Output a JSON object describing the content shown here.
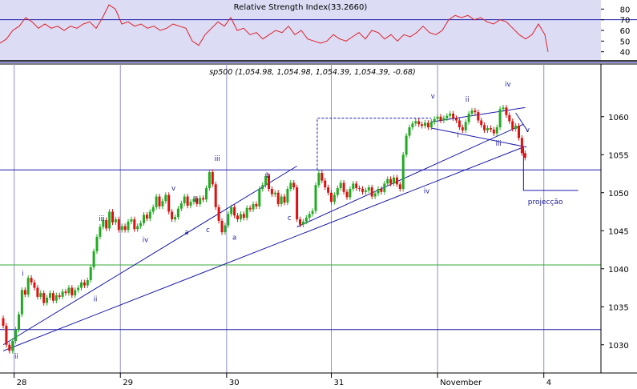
{
  "colors": {
    "background": "#ffffff",
    "rsi_background": "#dcdcf4",
    "rsi_line": "#e0202a",
    "frame": "#000000",
    "vgrid": "#9090c8",
    "blue_line": "#1a1aa8",
    "green_line": "#3aa83a",
    "bull": "#22aa22",
    "bear": "#e01010",
    "wave_label": "#1a1a9a",
    "orange_dash": "#cc3300"
  },
  "chart_data": [
    {
      "type": "line",
      "title": "Relative Strength Index(33.2660)",
      "ylim": [
        33,
        87
      ],
      "y_ticks": [
        40,
        50,
        60,
        70,
        80
      ],
      "reference_levels": [
        70,
        30
      ],
      "grid": false,
      "series": [
        {
          "x": [
            0,
            8,
            16,
            24,
            32,
            40,
            48,
            56,
            64,
            72,
            80,
            88,
            96,
            104,
            112,
            120,
            128,
            136,
            144,
            152,
            160,
            168,
            176,
            184,
            192,
            200,
            208,
            216,
            224,
            232,
            240,
            248,
            256,
            264,
            272,
            280,
            288,
            296,
            304,
            312,
            320,
            328,
            336,
            344,
            352,
            360,
            368,
            376,
            384,
            392,
            400,
            408,
            416,
            424,
            432,
            440,
            448,
            456,
            464,
            472,
            480,
            488,
            496,
            504,
            512,
            520,
            528,
            536,
            544,
            552,
            560,
            568,
            576,
            584,
            592,
            600,
            608,
            616,
            624,
            632,
            640,
            648,
            656,
            664,
            672,
            680,
            684
          ],
          "values": [
            48,
            52,
            60,
            64,
            72,
            68,
            62,
            66,
            62,
            64,
            60,
            64,
            62,
            66,
            68,
            62,
            72,
            84,
            80,
            66,
            68,
            64,
            66,
            62,
            64,
            60,
            62,
            66,
            64,
            62,
            50,
            46,
            56,
            62,
            68,
            64,
            72,
            60,
            62,
            56,
            58,
            52,
            56,
            60,
            58,
            64,
            56,
            60,
            52,
            50,
            48,
            50,
            56,
            52,
            50,
            54,
            58,
            52,
            60,
            58,
            52,
            56,
            50,
            56,
            54,
            58,
            64,
            58,
            56,
            60,
            70,
            74,
            72,
            74,
            70,
            72,
            68,
            66,
            70,
            68,
            62,
            56,
            52,
            56,
            66,
            56,
            40
          ]
        }
      ]
    },
    {
      "type": "candlestick",
      "title": "sp500 (1,054.98, 1,054.98, 1,054.39, 1,054.39, -0.68)",
      "ylim": [
        1026.5,
        1066.5
      ],
      "y_ticks": [
        1030,
        1035,
        1040,
        1045,
        1050,
        1055,
        1060
      ],
      "x_tick_labels": [
        "28",
        "29",
        "30",
        "31",
        "November",
        "4"
      ],
      "grid": false,
      "series": [
        {
          "name": "price",
          "values": [
            1032.5,
            1030,
            1029.2,
            1030.5,
            1032,
            1034,
            1037.2,
            1036.6,
            1038.8,
            1038.2,
            1037.5,
            1036.3,
            1036.8,
            1035.5,
            1036.2,
            1036.8,
            1035.8,
            1036.5,
            1036.3,
            1037,
            1036.8,
            1037.5,
            1036.5,
            1037.2,
            1037.5,
            1038.2,
            1037.8,
            1038.5,
            1040.2,
            1042.3,
            1044.2,
            1045.5,
            1046.4,
            1045.3,
            1047.5,
            1046.1,
            1046.5,
            1045.1,
            1045.6,
            1045.1,
            1046.2,
            1046.5,
            1045.2,
            1045.6,
            1046,
            1047.1,
            1046.6,
            1047.5,
            1048.1,
            1049.5,
            1048.2,
            1048.9,
            1049.7,
            1047.5,
            1046.5,
            1046.8,
            1047.9,
            1048.6,
            1049.5,
            1048.3,
            1048.8,
            1049.2,
            1048.5,
            1049.3,
            1049.1,
            1050.6,
            1052.7,
            1051.1,
            1048.1,
            1046.3,
            1044.8,
            1045.7,
            1047.2,
            1048.1,
            1047,
            1046.5,
            1047.2,
            1046.7,
            1048,
            1047.8,
            1048.5,
            1048.2,
            1050.5,
            1051,
            1052.2,
            1050.5,
            1049.8,
            1050,
            1048.5,
            1049.5,
            1048.7,
            1050.5,
            1051.3,
            1050.7,
            1046.5,
            1045.8,
            1046.2,
            1046.7,
            1047.2,
            1047.6,
            1051,
            1052.6,
            1051.6,
            1050.7,
            1050,
            1048.8,
            1049.7,
            1050.6,
            1051.3,
            1050.1,
            1049.4,
            1050.5,
            1051.2,
            1050.6,
            1050.5,
            1050.1,
            1050.3,
            1050.7,
            1049.5,
            1049.9,
            1050.5,
            1050.1,
            1051.2,
            1051.8,
            1051.2,
            1052,
            1051.1,
            1050.5,
            1055,
            1057.5,
            1058.6,
            1059.1,
            1059.4,
            1059,
            1058.8,
            1059.2,
            1058.6,
            1059.3,
            1059.7,
            1060,
            1059.5,
            1059.8,
            1060.1,
            1060.4,
            1059.8,
            1059.5,
            1058.6,
            1058.2,
            1059.3,
            1060.4,
            1060.8,
            1060.6,
            1059.5,
            1058.9,
            1058.2,
            1058.5,
            1058.3,
            1057.8,
            1058.6,
            1061,
            1061.2,
            1060.2,
            1059.4,
            1058.4,
            1058.8,
            1057.2,
            1055.2,
            1054.6
          ],
          "labels": [
            {
              "text": "ii",
              "x": 4.2,
              "y": 1028.2
            },
            {
              "text": "i",
              "x": 6.3,
              "y": 1039.1
            },
            {
              "text": "ii",
              "x": 29.5,
              "y": 1035.7
            },
            {
              "text": "iii",
              "x": 31.5,
              "y": 1046.3
            },
            {
              "text": "iv",
              "x": 45.5,
              "y": 1043.5
            },
            {
              "text": "v",
              "x": 54.5,
              "y": 1050.3
            },
            {
              "text": "a",
              "x": 58.7,
              "y": 1044.5
            },
            {
              "text": "b",
              "x": 61.8,
              "y": 1048.8
            },
            {
              "text": "c",
              "x": 65.5,
              "y": 1044.8
            },
            {
              "text": "iii",
              "x": 68.5,
              "y": 1054.2
            },
            {
              "text": "a",
              "x": 74,
              "y": 1043.8
            },
            {
              "text": "b",
              "x": 84.8,
              "y": 1052
            },
            {
              "text": "c",
              "x": 91.6,
              "y": 1046.4
            },
            {
              "text": "iv",
              "x": 135.5,
              "y": 1049.9
            },
            {
              "text": "v",
              "x": 137.5,
              "y": 1062.4
            },
            {
              "text": "i",
              "x": 145.5,
              "y": 1057.3
            },
            {
              "text": "ii",
              "x": 148.5,
              "y": 1062
            },
            {
              "text": "iii",
              "x": 158.5,
              "y": 1056.2
            },
            {
              "text": "iv",
              "x": 161.5,
              "y": 1064
            },
            {
              "text": "v",
              "x": 167.8,
              "y": 1058
            },
            {
              "text": "projecção",
              "x": 173.5,
              "y": 1048.5
            }
          ]
        }
      ],
      "reference_levels": {
        "blue": [
          1053,
          1032
        ],
        "green": 1040.5
      },
      "trendlines": [
        {
          "from": [
            0,
            1030
          ],
          "to": [
            94,
            1053.5
          ]
        },
        {
          "from": [
            0,
            1029.2
          ],
          "to": [
            166.5,
            1056
          ]
        },
        {
          "from": [
            94,
            1045.5
          ],
          "to": [
            166.5,
            1059
          ]
        },
        {
          "from": [
            137,
            1058.5
          ],
          "to": [
            167.5,
            1056
          ]
        },
        {
          "from": [
            137,
            1059.3
          ],
          "to": [
            167,
            1061.2
          ]
        },
        {
          "from": [
            164,
            1060.5
          ],
          "to": [
            168,
            1058
          ]
        }
      ],
      "projection_path": [
        [
          100.5,
          1053
        ],
        [
          100.5,
          1059.8
        ],
        [
          137,
          1059.8
        ]
      ],
      "projection_target": [
        [
          166.5,
          1056
        ],
        [
          166.5,
          1050.3
        ],
        [
          184,
          1050.3
        ]
      ]
    }
  ]
}
